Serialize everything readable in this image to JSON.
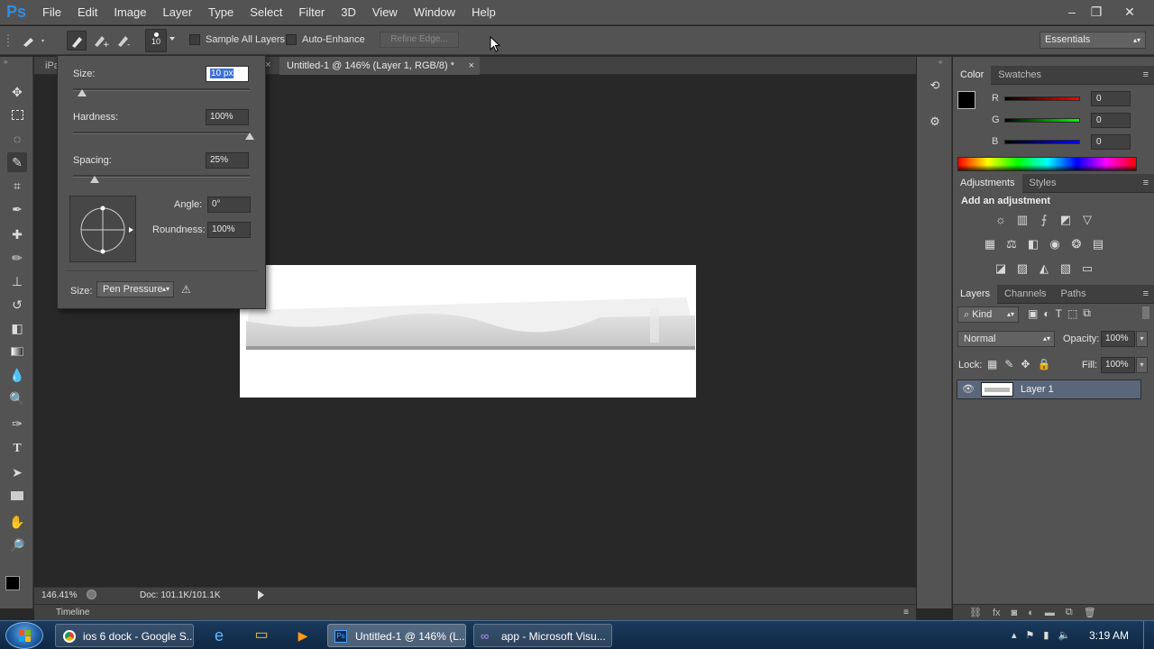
{
  "app": {
    "logo_text": "Ps"
  },
  "menu": [
    "File",
    "Edit",
    "Image",
    "Layer",
    "Type",
    "Select",
    "Filter",
    "3D",
    "View",
    "Window",
    "Help"
  ],
  "options_bar": {
    "brush_size": "10",
    "sample_all_layers": "Sample All Layers",
    "auto_enhance": "Auto-Enhance",
    "refine_edge": "Refine Edge...",
    "workspace": "Essentials"
  },
  "document": {
    "prev_tab_partial": "iPa",
    "active_tab": "Untitled-1 @ 146% (Layer 1, RGB/8) *",
    "zoom": "146.41%",
    "doc_info": "Doc: 101.1K/101.1K"
  },
  "brush_popup": {
    "size_label": "Size:",
    "size_value": "10 px",
    "size_level": 0.05,
    "hardness_label": "Hardness:",
    "hardness_value": "100%",
    "hardness_level": 1.0,
    "spacing_label": "Spacing:",
    "spacing_value": "25%",
    "spacing_level": 0.12,
    "angle_label": "Angle:",
    "angle_value": "0°",
    "roundness_label": "Roundness:",
    "roundness_value": "100%",
    "size_control_label": "Size:",
    "size_control_value": "Pen Pressure"
  },
  "color_panel": {
    "tabs": [
      "Color",
      "Swatches"
    ],
    "r_label": "R",
    "r_value": "0",
    "g_label": "G",
    "g_value": "0",
    "b_label": "B",
    "b_value": "0",
    "foreground": "#000000",
    "background": "#ffffff"
  },
  "adjustments_panel": {
    "tabs": [
      "Adjustments",
      "Styles"
    ],
    "heading": "Add an adjustment"
  },
  "layers_panel": {
    "tabs": [
      "Layers",
      "Channels",
      "Paths"
    ],
    "kind": "Kind",
    "blend_mode": "Normal",
    "opacity_label": "Opacity:",
    "opacity_value": "100%",
    "lock_label": "Lock:",
    "fill_label": "Fill:",
    "fill_value": "100%",
    "layers": [
      {
        "name": "Layer 1"
      }
    ]
  },
  "timeline": {
    "label": "Timeline"
  },
  "taskbar": {
    "items": [
      "ios 6 dock - Google S...",
      "Untitled-1 @ 146% (L...",
      "app - Microsoft Visu..."
    ],
    "time": "3:19 AM"
  }
}
